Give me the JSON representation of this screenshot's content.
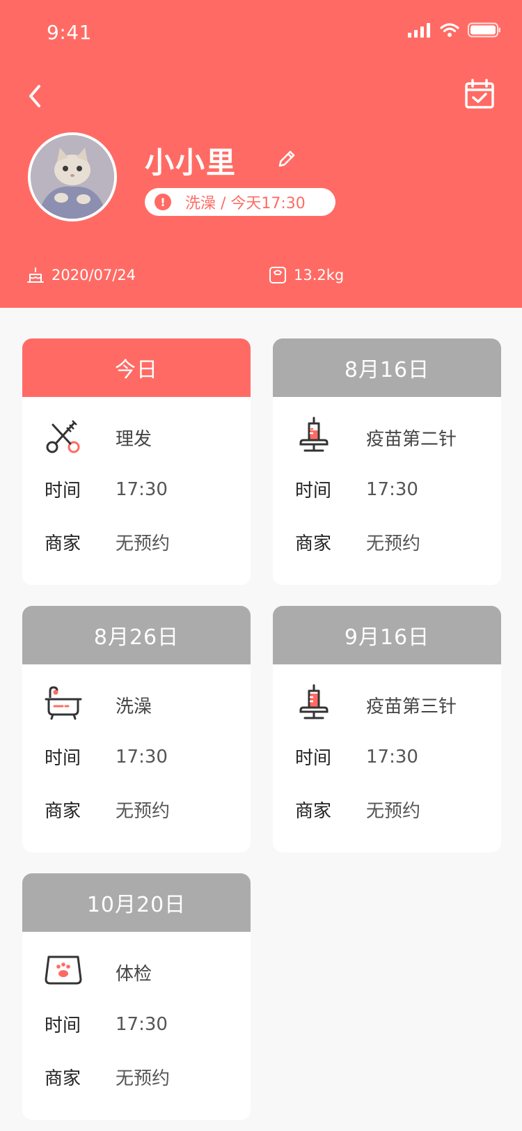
{
  "status": {
    "time": "9:41"
  },
  "profile": {
    "name": "小小里",
    "reminder": "洗澡 / 今天17:30",
    "birthday": "2020/07/24",
    "weight": "13.2kg"
  },
  "labels": {
    "time": "时间",
    "merchant": "商家"
  },
  "cards": [
    {
      "date": "今日",
      "service": "理发",
      "icon": "scissors-icon",
      "time": "17:30",
      "merchant": "无预约",
      "active": true
    },
    {
      "date": "8月16日",
      "service": "疫苗第二针",
      "icon": "syringe-icon",
      "time": "17:30",
      "merchant": "无预约",
      "active": false
    },
    {
      "date": "8月26日",
      "service": "洗澡",
      "icon": "bathtub-icon",
      "time": "17:30",
      "merchant": "无预约",
      "active": false
    },
    {
      "date": "9月16日",
      "service": "疫苗第三针",
      "icon": "syringe-icon",
      "time": "17:30",
      "merchant": "无预约",
      "active": false
    },
    {
      "date": "10月20日",
      "service": "体检",
      "icon": "scale-icon",
      "time": "17:30",
      "merchant": "无预约",
      "active": false
    }
  ],
  "colors": {
    "accent": "#ff6b64",
    "inactive_header": "#ababab",
    "background": "#f8f8f8"
  }
}
